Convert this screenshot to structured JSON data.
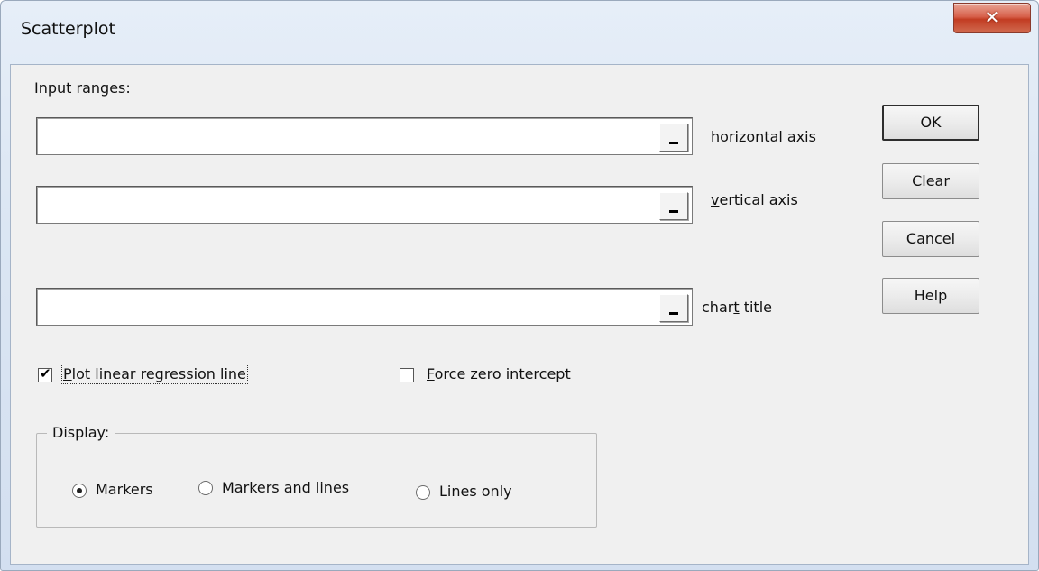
{
  "window": {
    "title": "Scatterplot",
    "close_glyph": "✕"
  },
  "input_ranges": {
    "heading": "Input ranges:",
    "horizontal": {
      "value": "",
      "label_pre": "h",
      "label_accel": "o",
      "label_post": "rizontal axis"
    },
    "vertical": {
      "value": "",
      "label_pre": "",
      "label_accel": "v",
      "label_post": "ertical axis"
    },
    "title": {
      "value": "",
      "label_pre": "char",
      "label_accel": "t",
      "label_post": " title"
    }
  },
  "buttons": {
    "ok": "OK",
    "clear": "Clear",
    "cancel": "Cancel",
    "help": "Help"
  },
  "options": {
    "plot_regression": {
      "checked": true,
      "label_accel": "P",
      "label_post": "lot linear regression line"
    },
    "force_zero": {
      "checked": false,
      "label_accel": "F",
      "label_post": "orce zero intercept"
    }
  },
  "display": {
    "title": "Display:",
    "options": [
      {
        "label": "Markers",
        "selected": true
      },
      {
        "label": "Markers and lines",
        "selected": false
      },
      {
        "label": "Lines only",
        "selected": false
      }
    ]
  }
}
